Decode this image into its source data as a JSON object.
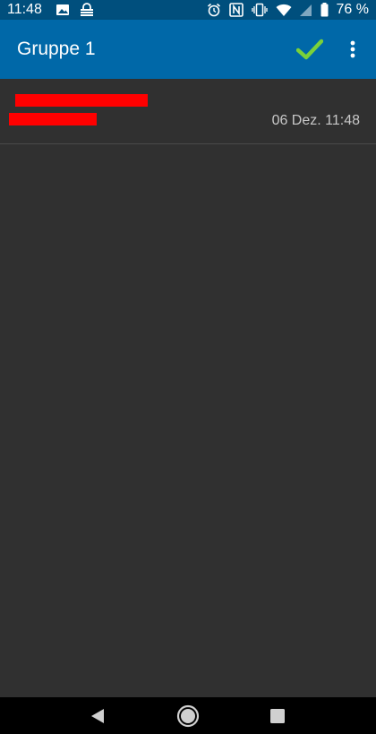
{
  "status_bar": {
    "time": "11:48",
    "battery_text": "76 %",
    "icons_left": [
      "image-icon",
      "vpn-lock-icon"
    ],
    "icons_right": [
      "alarm-icon",
      "nfc-icon",
      "vibrate-icon",
      "wifi-icon",
      "signal-icon",
      "battery-icon"
    ]
  },
  "app_bar": {
    "title": "Gruppe 1",
    "confirm_icon": "check-icon",
    "overflow_icon": "more-vert-icon"
  },
  "list": {
    "items": [
      {
        "title": "",
        "subtitle": "",
        "date": "06 Dez. 11:48",
        "redacted": true
      }
    ]
  },
  "nav_bar": {
    "back_icon": "back-triangle-icon",
    "home_icon": "home-circle-icon",
    "recents_icon": "recents-square-icon"
  },
  "colors": {
    "status_bar": "#004f7d",
    "app_bar": "#0068a8",
    "background": "#303030",
    "check": "#7ad13a",
    "redaction": "#ff0000",
    "nav_bar": "#000000"
  }
}
